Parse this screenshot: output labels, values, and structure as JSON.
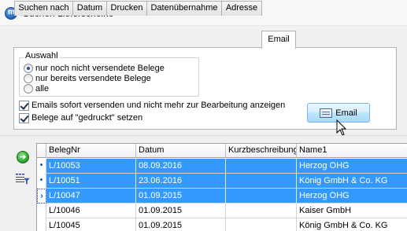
{
  "window": {
    "title": "Suchen Lieferscheine",
    "app_icon": "app-logo-icon"
  },
  "tabs": [
    {
      "label": "Suchen nach",
      "active": false
    },
    {
      "label": "Datum",
      "active": false
    },
    {
      "label": "Drucken",
      "active": false
    },
    {
      "label": "Datenübernahme",
      "active": false
    },
    {
      "label": "Adresse",
      "active": false
    },
    {
      "label": "Email",
      "active": true
    }
  ],
  "auswahl": {
    "label": "Auswahl",
    "options": [
      {
        "label": "nur noch nicht versendete Belege",
        "selected": true
      },
      {
        "label": "nur bereits versendete Belege",
        "selected": false
      },
      {
        "label": "alle",
        "selected": false
      }
    ]
  },
  "checkboxes": [
    {
      "label": "Emails sofort versenden und nicht mehr zur Bearbeitung anzeigen",
      "checked": true
    },
    {
      "label": "Belege auf \"gedruckt\" setzen",
      "checked": true
    }
  ],
  "email_button": {
    "label": "Email",
    "icon": "email-icon"
  },
  "side_icons": {
    "go": "go-arrow-icon",
    "filter": "filter-columns-icon"
  },
  "grid": {
    "columns": [
      "BelegNr",
      "Datum",
      "Kurzbeschreibung",
      "Name1"
    ],
    "rows": [
      {
        "indicator": "•",
        "selected": true,
        "cells": [
          "L/10053",
          "08.09.2016",
          "",
          "Herzog OHG"
        ]
      },
      {
        "indicator": "•",
        "selected": true,
        "cells": [
          "L/10051",
          "23.06.2016",
          "",
          "König GmbH & Co. KG"
        ]
      },
      {
        "indicator": "›",
        "selected": true,
        "current": true,
        "cells": [
          "L/10047",
          "01.09.2015",
          "",
          "Herzog OHG"
        ]
      },
      {
        "indicator": "",
        "selected": false,
        "cells": [
          "L/10046",
          "01.09.2015",
          "",
          "Kaiser GmbH"
        ]
      },
      {
        "indicator": "",
        "selected": false,
        "cells": [
          "L/10045",
          "01.09.2015",
          "",
          "König GmbH & Co. KG"
        ]
      }
    ]
  },
  "colors": {
    "selection": "#3399ff",
    "accent": "#1b3f9a"
  }
}
